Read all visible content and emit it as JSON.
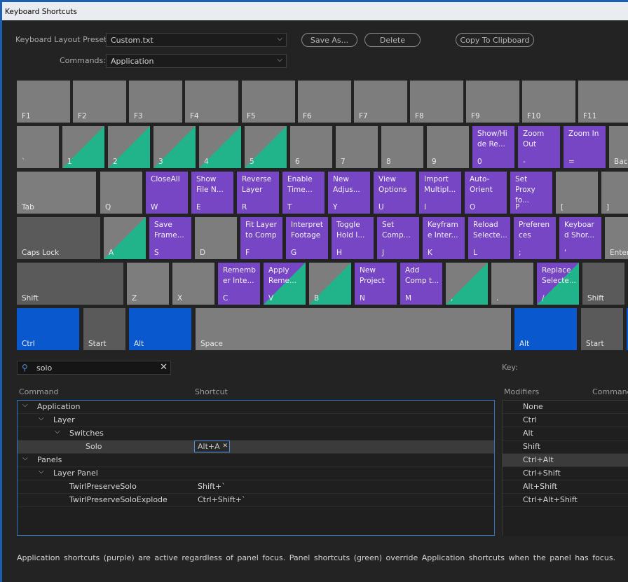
{
  "window": {
    "title": "Keyboard Shortcuts"
  },
  "controls": {
    "preset_label": "Keyboard Layout Preset:",
    "preset_value": "Custom.txt",
    "commands_label": "Commands:",
    "commands_value": "Application",
    "save_as": "Save As...",
    "delete": "Delete",
    "copy_clipboard": "Copy To Clipboard"
  },
  "keyboard": {
    "keys": [
      {
        "cap": "F1",
        "cmd": "",
        "style": "gray"
      },
      {
        "cap": "F2",
        "cmd": "",
        "style": "gray"
      },
      {
        "cap": "F3",
        "cmd": "",
        "style": "gray"
      },
      {
        "cap": "F4",
        "cmd": "",
        "style": "gray"
      },
      {
        "cap": "F5",
        "cmd": "",
        "style": "gray"
      },
      {
        "cap": "F6",
        "cmd": "",
        "style": "gray"
      },
      {
        "cap": "F7",
        "cmd": "",
        "style": "gray"
      },
      {
        "cap": "F8",
        "cmd": "",
        "style": "gray"
      },
      {
        "cap": "F9",
        "cmd": "",
        "style": "gray"
      },
      {
        "cap": "F10",
        "cmd": "",
        "style": "gray"
      },
      {
        "cap": "F11",
        "cmd": "",
        "style": "gray"
      },
      {
        "cap": "`",
        "cmd": "",
        "style": "gray"
      },
      {
        "cap": "1",
        "cmd": "",
        "style": "green"
      },
      {
        "cap": "2",
        "cmd": "",
        "style": "green"
      },
      {
        "cap": "3",
        "cmd": "",
        "style": "green"
      },
      {
        "cap": "4",
        "cmd": "",
        "style": "green"
      },
      {
        "cap": "5",
        "cmd": "",
        "style": "green"
      },
      {
        "cap": "6",
        "cmd": "",
        "style": "gray"
      },
      {
        "cap": "7",
        "cmd": "",
        "style": "gray"
      },
      {
        "cap": "8",
        "cmd": "",
        "style": "gray"
      },
      {
        "cap": "9",
        "cmd": "",
        "style": "gray"
      },
      {
        "cap": "0",
        "cmd": "Show/Hi de Re...",
        "style": "purple"
      },
      {
        "cap": "-",
        "cmd": "Zoom Out",
        "style": "purple"
      },
      {
        "cap": "=",
        "cmd": "Zoom In",
        "style": "purple"
      },
      {
        "cap": "Back",
        "cmd": "",
        "style": "gray"
      },
      {
        "cap": "Tab",
        "cmd": "",
        "style": "gray"
      },
      {
        "cap": "Q",
        "cmd": "",
        "style": "gray"
      },
      {
        "cap": "W",
        "cmd": "CloseAll",
        "style": "purple"
      },
      {
        "cap": "E",
        "cmd": "Show File N...",
        "style": "purple"
      },
      {
        "cap": "R",
        "cmd": "Reverse Layer",
        "style": "purple"
      },
      {
        "cap": "T",
        "cmd": "Enable Time...",
        "style": "purple"
      },
      {
        "cap": "Y",
        "cmd": "New Adjus...",
        "style": "purple"
      },
      {
        "cap": "U",
        "cmd": "View Options",
        "style": "purple"
      },
      {
        "cap": "I",
        "cmd": "Import Multipl...",
        "style": "purple"
      },
      {
        "cap": "O",
        "cmd": "Auto-Orient",
        "style": "purple"
      },
      {
        "cap": "P",
        "cmd": "Set Proxy fo...",
        "style": "purple"
      },
      {
        "cap": "[",
        "cmd": "",
        "style": "gray"
      },
      {
        "cap": "]",
        "cmd": "",
        "style": "gray"
      },
      {
        "cap": "Caps Lock",
        "cmd": "",
        "style": "dark"
      },
      {
        "cap": "A",
        "cmd": "",
        "style": "green"
      },
      {
        "cap": "S",
        "cmd": "Save Frame...",
        "style": "purple"
      },
      {
        "cap": "D",
        "cmd": "",
        "style": "gray"
      },
      {
        "cap": "F",
        "cmd": "Fit Layer to Comp",
        "style": "purple"
      },
      {
        "cap": "G",
        "cmd": "Interpret Footage",
        "style": "purple"
      },
      {
        "cap": "H",
        "cmd": "Toggle Hold I...",
        "style": "purple"
      },
      {
        "cap": "J",
        "cmd": "Set Comp...",
        "style": "purple"
      },
      {
        "cap": "K",
        "cmd": "Keyfram e Inter...",
        "style": "purple"
      },
      {
        "cap": "L",
        "cmd": "Reload Selecte...",
        "style": "purple"
      },
      {
        "cap": ";",
        "cmd": "Preferen ces",
        "style": "purple"
      },
      {
        "cap": "'",
        "cmd": "Keyboar d Shor...",
        "style": "purple"
      },
      {
        "cap": "Enter",
        "cmd": "",
        "style": "gray"
      },
      {
        "cap": "Shift",
        "cmd": "",
        "style": "dark"
      },
      {
        "cap": "Z",
        "cmd": "",
        "style": "gray"
      },
      {
        "cap": "X",
        "cmd": "",
        "style": "gray"
      },
      {
        "cap": "C",
        "cmd": "Rememb er Inte...",
        "style": "purple"
      },
      {
        "cap": "V",
        "cmd": "Apply Reme...",
        "style": "pg"
      },
      {
        "cap": "B",
        "cmd": "",
        "style": "green"
      },
      {
        "cap": "N",
        "cmd": "New Project",
        "style": "purple"
      },
      {
        "cap": "M",
        "cmd": "Add Comp t...",
        "style": "purple"
      },
      {
        "cap": ",",
        "cmd": "",
        "style": "green"
      },
      {
        "cap": ".",
        "cmd": "",
        "style": "gray"
      },
      {
        "cap": "/",
        "cmd": "Replace Selecte...",
        "style": "pg"
      },
      {
        "cap": "Shift",
        "cmd": "",
        "style": "dark"
      },
      {
        "cap": "Ctrl",
        "cmd": "",
        "style": "blue"
      },
      {
        "cap": "Start",
        "cmd": "",
        "style": "dark"
      },
      {
        "cap": "Alt",
        "cmd": "",
        "style": "blue"
      },
      {
        "cap": "Space",
        "cmd": "",
        "style": "gray"
      },
      {
        "cap": "Alt",
        "cmd": "",
        "style": "blue"
      },
      {
        "cap": "Start",
        "cmd": "",
        "style": "dark"
      },
      {
        "cap": "",
        "cmd": "",
        "style": "blue"
      }
    ]
  },
  "search": {
    "value": "solo"
  },
  "key_label": "Key:",
  "command_table": {
    "headers": {
      "command": "Command",
      "shortcut": "Shortcut"
    },
    "rows": [
      {
        "text": "Application",
        "shortcut": ""
      },
      {
        "text": "Layer",
        "shortcut": ""
      },
      {
        "text": "Switches",
        "shortcut": ""
      },
      {
        "text": "Solo",
        "shortcut": "Alt+A"
      },
      {
        "text": "Panels",
        "shortcut": ""
      },
      {
        "text": "Layer Panel",
        "shortcut": ""
      },
      {
        "text": "TwirlPreserveSolo",
        "shortcut": "Shift+`"
      },
      {
        "text": "TwirlPreserveSoloExplode",
        "shortcut": "Ctrl+Shift+`"
      }
    ]
  },
  "modifier_table": {
    "headers": {
      "modifiers": "Modifiers",
      "command": "Command"
    },
    "rows": [
      "None",
      "Ctrl",
      "Alt",
      "Shift",
      "Ctrl+Alt",
      "Ctrl+Shift",
      "Alt+Shift",
      "Ctrl+Alt+Shift"
    ]
  },
  "footer": "Application shortcuts (purple) are active regardless of panel focus. Panel shortcuts (green) override Application shortcuts when the panel has focus."
}
